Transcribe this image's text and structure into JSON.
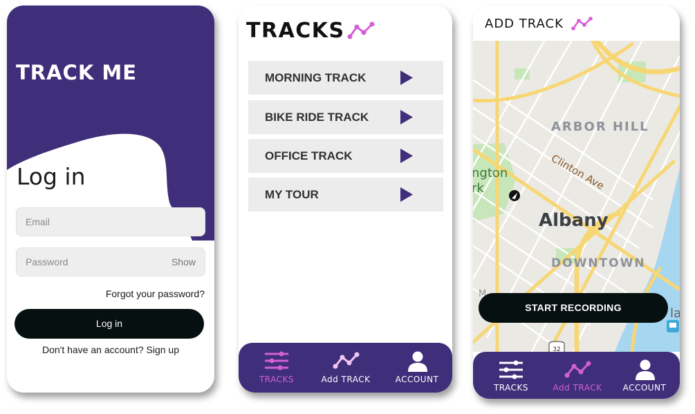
{
  "colors": {
    "brand_purple": "#3f2f7b",
    "accent_pink": "#d45fd4",
    "button_dark": "#061010",
    "map_road": "#f7d774",
    "map_water": "#a7d6f0",
    "map_park": "#c7e6b9"
  },
  "login_screen": {
    "app_title": "TRACK ME",
    "heading": "Log in",
    "email_placeholder": "Email",
    "password_placeholder": "Password",
    "show_label": "Show",
    "forgot_password": "Forgot your password?",
    "login_button": "Log in",
    "signup_text": "Don't have an account? Sign up"
  },
  "tracks_screen": {
    "title": "TRACKS",
    "logo_icon": "route-icon",
    "tracks": [
      {
        "label": "MORNING TRACK",
        "icon": "play-arrow-icon"
      },
      {
        "label": "BIKE RIDE TRACK",
        "icon": "play-arrow-icon"
      },
      {
        "label": "OFFICE TRACK",
        "icon": "play-arrow-icon"
      },
      {
        "label": "MY TOUR",
        "icon": "play-arrow-icon"
      }
    ],
    "nav": [
      {
        "label": "TRACKS",
        "icon": "sliders-icon",
        "active": true
      },
      {
        "label": "Add TRACK",
        "icon": "route-icon",
        "active": false
      },
      {
        "label": "ACCOUNT",
        "icon": "person-icon",
        "active": false
      }
    ]
  },
  "add_track_screen": {
    "title": "ADD TRACK",
    "map_labels": {
      "arbor_hill": "ARBOR HILL",
      "clinton": "Clinton Ave",
      "albany": "Albany",
      "downtown": "DOWNTOWN",
      "park_1": "ngton",
      "park_2": "rk",
      "edge_la": "la",
      "edge_m": "M",
      "route_number": "32"
    },
    "start_button": "START RECORDING",
    "nav": [
      {
        "label": "TRACKS",
        "icon": "sliders-icon",
        "active": false
      },
      {
        "label": "Add TRACK",
        "icon": "route-icon",
        "active": true
      },
      {
        "label": "ACCOUNT",
        "icon": "person-icon",
        "active": false
      }
    ]
  }
}
